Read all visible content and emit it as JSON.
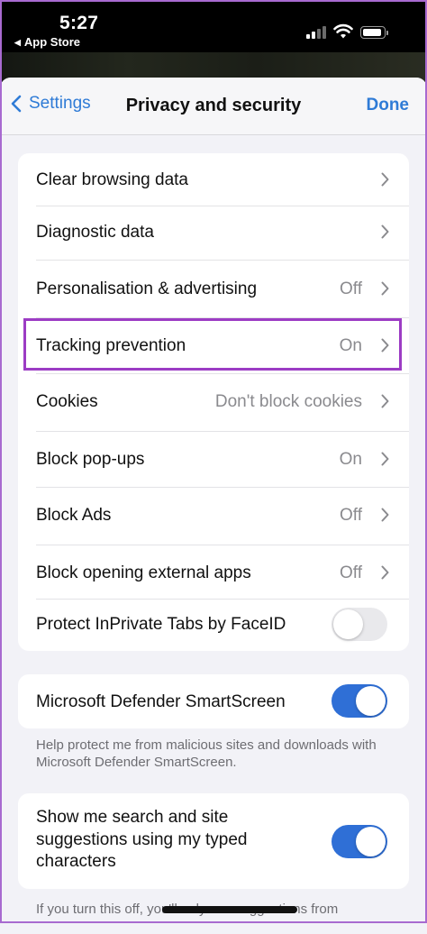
{
  "status_bar": {
    "time": "5:27",
    "back_app": "App Store",
    "icons": [
      "signal-icon",
      "wifi-icon",
      "battery-icon"
    ]
  },
  "nav": {
    "back_label": "Settings",
    "title": "Privacy and security",
    "done_label": "Done"
  },
  "settings": {
    "clear_browsing": {
      "label": "Clear browsing data"
    },
    "diagnostic": {
      "label": "Diagnostic data"
    },
    "personalisation": {
      "label": "Personalisation & advertising",
      "value": "Off"
    },
    "tracking": {
      "label": "Tracking prevention",
      "value": "On"
    },
    "cookies": {
      "label": "Cookies",
      "value": "Don't block cookies"
    },
    "popups": {
      "label": "Block pop-ups",
      "value": "On"
    },
    "ads": {
      "label": "Block Ads",
      "value": "Off"
    },
    "external_apps": {
      "label": "Block opening external apps",
      "value": "Off"
    },
    "inprivate": {
      "label": "Protect InPrivate Tabs by FaceID",
      "toggle": false
    }
  },
  "smartscreen": {
    "label": "Microsoft Defender SmartScreen",
    "toggle": true,
    "footnote": "Help protect me from malicious sites and downloads with Microsoft Defender SmartScreen."
  },
  "suggestions": {
    "label": "Show me search and site suggestions using my typed characters",
    "toggle": true,
    "footnote": "If you turn this off, you'll only see suggestions from"
  },
  "colors": {
    "accent": "#2f7bd6",
    "toggle_on": "#2f6fd6",
    "highlight": "#9c3cc4"
  }
}
